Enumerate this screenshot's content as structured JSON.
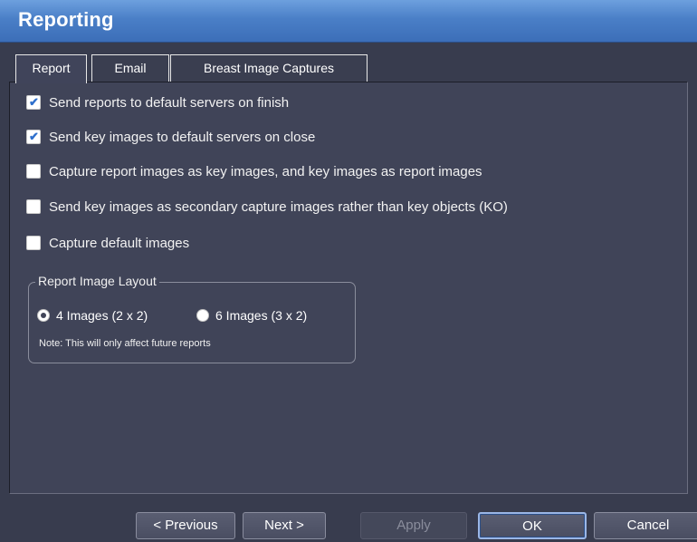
{
  "window": {
    "title": "Reporting"
  },
  "tabs": [
    {
      "label": "Report",
      "active": true
    },
    {
      "label": "Email",
      "active": false
    },
    {
      "label": "Breast Image Captures",
      "active": false
    }
  ],
  "options": [
    {
      "label": "Send reports to default servers on finish",
      "checked": true
    },
    {
      "label": "Send key images to default servers on close",
      "checked": true
    },
    {
      "label": "Capture report images as key images, and key images as report images",
      "checked": false
    },
    {
      "label": "Send key images as secondary capture images rather than key objects (KO)",
      "checked": false
    },
    {
      "label": "Capture default images",
      "checked": false
    }
  ],
  "layout_group": {
    "title": "Report Image Layout",
    "options": [
      {
        "label": "4 Images (2 x 2)",
        "selected": true
      },
      {
        "label": "6 Images (3 x 2)",
        "selected": false
      }
    ],
    "note": "Note: This will only affect future reports"
  },
  "buttons": {
    "previous": "< Previous",
    "next": "Next >",
    "apply": "Apply",
    "ok": "OK",
    "cancel": "Cancel"
  },
  "colors": {
    "titlebar": "#4a7fc7",
    "background": "#383c4e",
    "panel": "#404458",
    "check_accent": "#2e6fcc"
  }
}
